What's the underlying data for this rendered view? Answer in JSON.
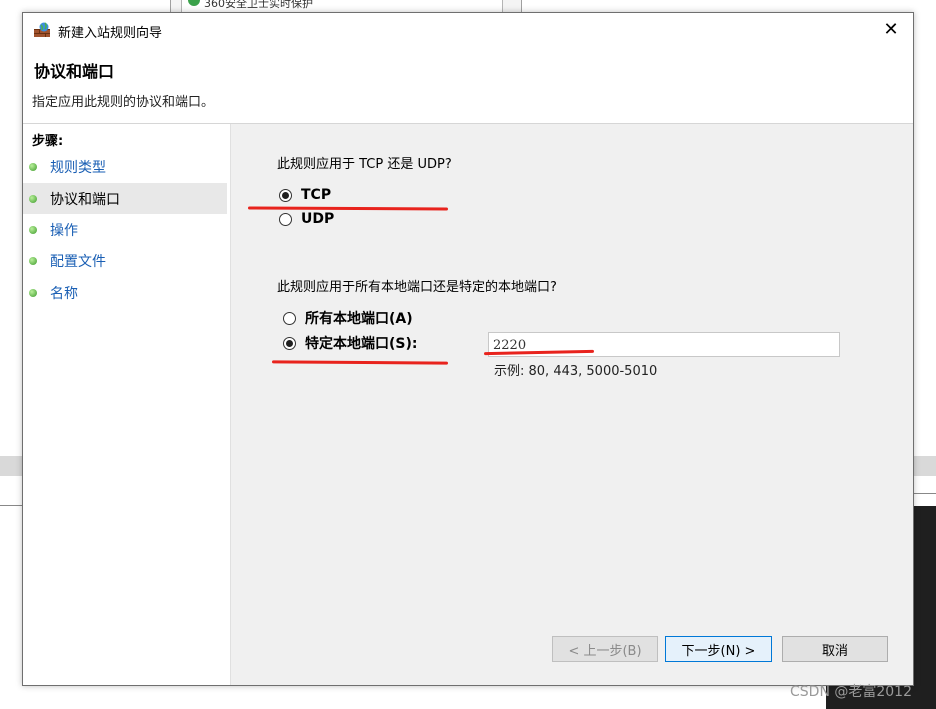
{
  "background": {
    "top_window_text": "360安全卫士实时保护"
  },
  "window": {
    "title": "新建入站规则向导",
    "close_label": "✕",
    "page_title": "协议和端口",
    "page_subtitle": "指定应用此规则的协议和端口。"
  },
  "steps": {
    "header": "步骤:",
    "items": [
      {
        "label": "规则类型",
        "active": false
      },
      {
        "label": "协议和端口",
        "active": true
      },
      {
        "label": "操作",
        "active": false
      },
      {
        "label": "配置文件",
        "active": false
      },
      {
        "label": "名称",
        "active": false
      }
    ]
  },
  "protocol": {
    "question": "此规则应用于 TCP 还是 UDP?",
    "options": [
      {
        "label": "TCP",
        "checked": true
      },
      {
        "label": "UDP",
        "checked": false
      }
    ]
  },
  "ports": {
    "question": "此规则应用于所有本地端口还是特定的本地端口?",
    "options": [
      {
        "label": "所有本地端口(A)",
        "checked": false
      },
      {
        "label": "特定本地端口(S):",
        "checked": true
      }
    ],
    "input_value": "2220",
    "example": "示例: 80, 443, 5000-5010"
  },
  "buttons": {
    "back": "< 上一步(B)",
    "next": "下一步(N) >",
    "cancel": "取消"
  },
  "watermark": "CSDN @老富2012",
  "colors": {
    "link_blue": "#1a5fb4",
    "annotation_red": "#e8231d",
    "bullet_green": "#3d9a2c"
  }
}
